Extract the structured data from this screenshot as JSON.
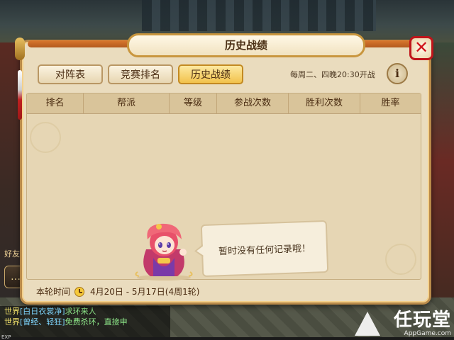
{
  "dialog": {
    "title": "历史战绩",
    "close_symbol": "✕",
    "tabs": [
      {
        "label": "对阵表",
        "active": false
      },
      {
        "label": "竞赛排名",
        "active": false
      },
      {
        "label": "历史战绩",
        "active": true
      }
    ],
    "schedule_text": "每周二、四晚20:30开战",
    "info_symbol": "i",
    "table": {
      "columns": [
        "排名",
        "帮派",
        "等级",
        "参战次数",
        "胜利次数",
        "胜率"
      ],
      "rows": []
    },
    "empty_message": "暂时没有任何记录哦！",
    "footer": {
      "label": "本轮时间",
      "range": "4月20日 - 5月17日(4周1轮)"
    }
  },
  "hud": {
    "friend_label": "好友",
    "chat_icon": "…",
    "chat": [
      {
        "channel": "世界",
        "name": "[白日衣裳净]",
        "text": "求环来人"
      },
      {
        "channel": "世界",
        "name": "[曾经、轻狂]",
        "text": "免费杀环，直接申"
      }
    ],
    "exp_label": "EXP"
  },
  "watermark": {
    "main": "任玩堂",
    "sub": "AppGame.com"
  },
  "colors": {
    "panel": "#eadcbe",
    "frame": "#b98a4a",
    "tab_active": "#f2c24c",
    "close_red": "#d0161c"
  }
}
